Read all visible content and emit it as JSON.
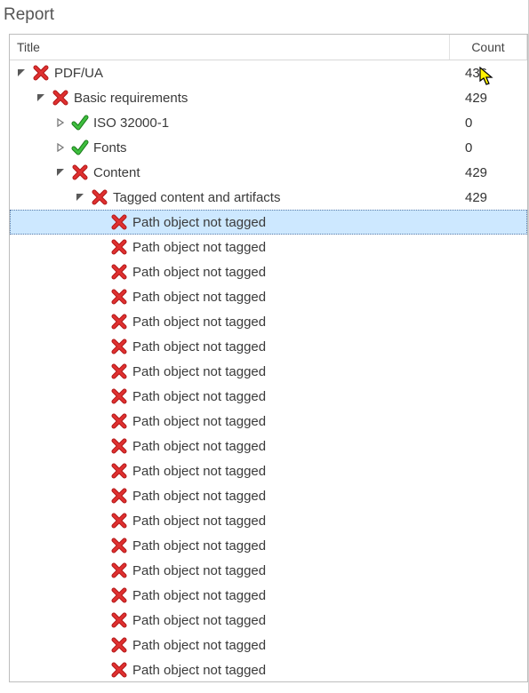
{
  "panel": {
    "title": "Report"
  },
  "columns": {
    "title": "Title",
    "count": "Count"
  },
  "icons": {
    "error": "error-icon",
    "ok": "check-icon"
  },
  "tree": [
    {
      "depth": 0,
      "expander": "open",
      "icon": "error",
      "label": "PDF/UA",
      "count": "436",
      "selected": false,
      "name": "node-pdfua"
    },
    {
      "depth": 1,
      "expander": "open",
      "icon": "error",
      "label": "Basic requirements",
      "count": "429",
      "selected": false,
      "name": "node-basic-requirements"
    },
    {
      "depth": 2,
      "expander": "closed",
      "icon": "ok",
      "label": "ISO 32000-1",
      "count": "0",
      "selected": false,
      "name": "node-iso-32000-1"
    },
    {
      "depth": 2,
      "expander": "closed",
      "icon": "ok",
      "label": "Fonts",
      "count": "0",
      "selected": false,
      "name": "node-fonts"
    },
    {
      "depth": 2,
      "expander": "open",
      "icon": "error",
      "label": "Content",
      "count": "429",
      "selected": false,
      "name": "node-content"
    },
    {
      "depth": 3,
      "expander": "open",
      "icon": "error",
      "label": "Tagged content and artifacts",
      "count": "429",
      "selected": false,
      "name": "node-tagged-content-artifacts"
    },
    {
      "depth": 4,
      "expander": "none",
      "icon": "error",
      "label": "Path object not tagged",
      "count": "",
      "selected": true,
      "name": "node-path-not-tagged"
    },
    {
      "depth": 4,
      "expander": "none",
      "icon": "error",
      "label": "Path object not tagged",
      "count": "",
      "selected": false,
      "name": "node-path-not-tagged"
    },
    {
      "depth": 4,
      "expander": "none",
      "icon": "error",
      "label": "Path object not tagged",
      "count": "",
      "selected": false,
      "name": "node-path-not-tagged"
    },
    {
      "depth": 4,
      "expander": "none",
      "icon": "error",
      "label": "Path object not tagged",
      "count": "",
      "selected": false,
      "name": "node-path-not-tagged"
    },
    {
      "depth": 4,
      "expander": "none",
      "icon": "error",
      "label": "Path object not tagged",
      "count": "",
      "selected": false,
      "name": "node-path-not-tagged"
    },
    {
      "depth": 4,
      "expander": "none",
      "icon": "error",
      "label": "Path object not tagged",
      "count": "",
      "selected": false,
      "name": "node-path-not-tagged"
    },
    {
      "depth": 4,
      "expander": "none",
      "icon": "error",
      "label": "Path object not tagged",
      "count": "",
      "selected": false,
      "name": "node-path-not-tagged"
    },
    {
      "depth": 4,
      "expander": "none",
      "icon": "error",
      "label": "Path object not tagged",
      "count": "",
      "selected": false,
      "name": "node-path-not-tagged"
    },
    {
      "depth": 4,
      "expander": "none",
      "icon": "error",
      "label": "Path object not tagged",
      "count": "",
      "selected": false,
      "name": "node-path-not-tagged"
    },
    {
      "depth": 4,
      "expander": "none",
      "icon": "error",
      "label": "Path object not tagged",
      "count": "",
      "selected": false,
      "name": "node-path-not-tagged"
    },
    {
      "depth": 4,
      "expander": "none",
      "icon": "error",
      "label": "Path object not tagged",
      "count": "",
      "selected": false,
      "name": "node-path-not-tagged"
    },
    {
      "depth": 4,
      "expander": "none",
      "icon": "error",
      "label": "Path object not tagged",
      "count": "",
      "selected": false,
      "name": "node-path-not-tagged"
    },
    {
      "depth": 4,
      "expander": "none",
      "icon": "error",
      "label": "Path object not tagged",
      "count": "",
      "selected": false,
      "name": "node-path-not-tagged"
    },
    {
      "depth": 4,
      "expander": "none",
      "icon": "error",
      "label": "Path object not tagged",
      "count": "",
      "selected": false,
      "name": "node-path-not-tagged"
    },
    {
      "depth": 4,
      "expander": "none",
      "icon": "error",
      "label": "Path object not tagged",
      "count": "",
      "selected": false,
      "name": "node-path-not-tagged"
    },
    {
      "depth": 4,
      "expander": "none",
      "icon": "error",
      "label": "Path object not tagged",
      "count": "",
      "selected": false,
      "name": "node-path-not-tagged"
    },
    {
      "depth": 4,
      "expander": "none",
      "icon": "error",
      "label": "Path object not tagged",
      "count": "",
      "selected": false,
      "name": "node-path-not-tagged"
    },
    {
      "depth": 4,
      "expander": "none",
      "icon": "error",
      "label": "Path object not tagged",
      "count": "",
      "selected": false,
      "name": "node-path-not-tagged"
    },
    {
      "depth": 4,
      "expander": "none",
      "icon": "error",
      "label": "Path object not tagged",
      "count": "",
      "selected": false,
      "name": "node-path-not-tagged"
    }
  ]
}
